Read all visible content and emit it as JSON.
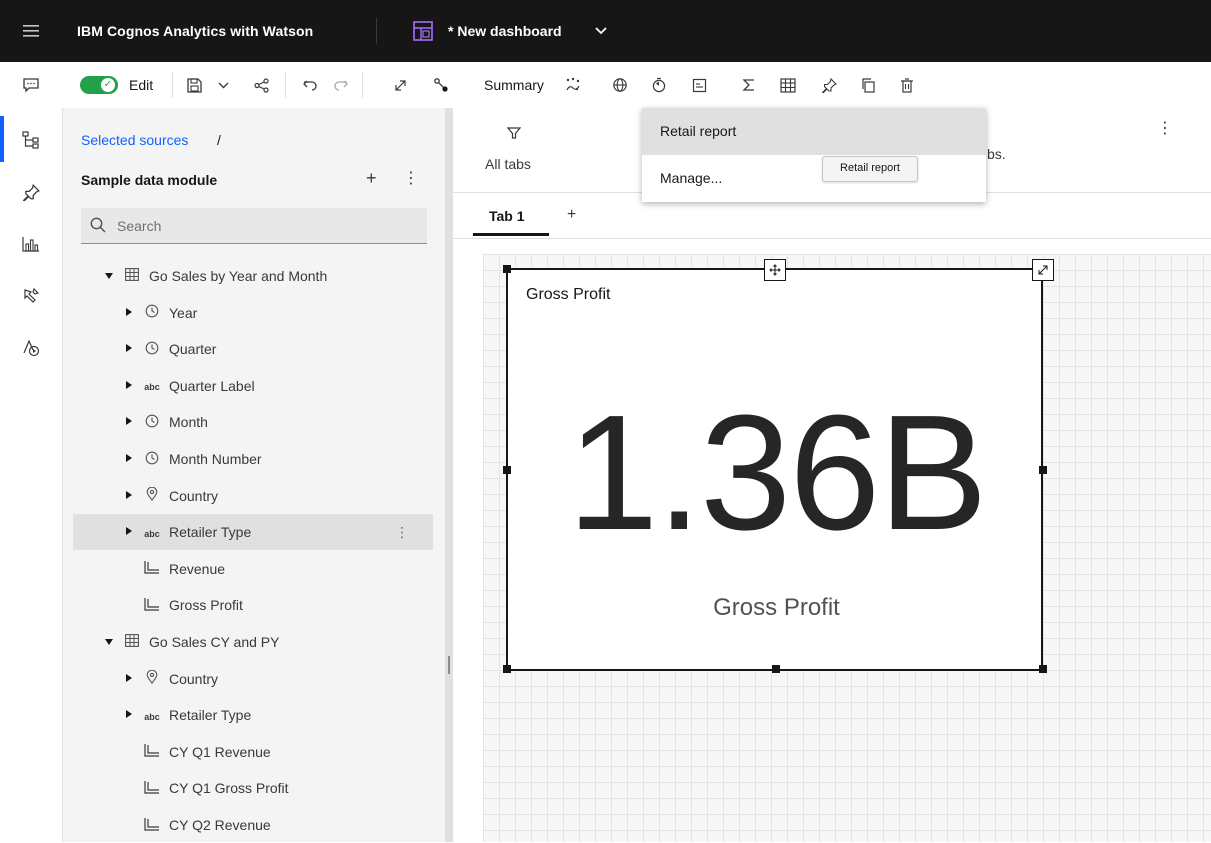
{
  "header": {
    "brand": "IBM Cognos Analytics with Watson",
    "dashboard_title": "* New dashboard"
  },
  "toolbar": {
    "edit_label": "Edit",
    "edit_on": true,
    "summary_label": "Summary"
  },
  "panel": {
    "breadcrumb_link": "Selected sources",
    "breadcrumb_sep": "/",
    "module_name": "Sample data module",
    "search_placeholder": "Search",
    "tree": [
      {
        "label": "Go Sales by Year and Month",
        "icon": "table-icon",
        "caret": "down",
        "level": 0
      },
      {
        "label": "Year",
        "icon": "clock-icon",
        "caret": "right",
        "level": 1
      },
      {
        "label": "Quarter",
        "icon": "clock-icon",
        "caret": "right",
        "level": 1
      },
      {
        "label": "Quarter Label",
        "icon": "abc-icon",
        "caret": "right",
        "level": 1
      },
      {
        "label": "Month",
        "icon": "clock-icon",
        "caret": "right",
        "level": 1
      },
      {
        "label": "Month Number",
        "icon": "clock-icon",
        "caret": "right",
        "level": 1
      },
      {
        "label": "Country",
        "icon": "location-icon",
        "caret": "right",
        "level": 1
      },
      {
        "label": "Retailer Type",
        "icon": "abc-icon",
        "caret": "right",
        "level": 1,
        "highlighted": true
      },
      {
        "label": "Revenue",
        "icon": "measure-icon",
        "caret": "none",
        "level": 1
      },
      {
        "label": "Gross Profit",
        "icon": "measure-icon",
        "caret": "none",
        "level": 1
      },
      {
        "label": "Go Sales CY and PY",
        "icon": "table-icon",
        "caret": "down",
        "level": 0
      },
      {
        "label": "Country",
        "icon": "location-icon",
        "caret": "right",
        "level": 1
      },
      {
        "label": "Retailer Type",
        "icon": "abc-icon",
        "caret": "right",
        "level": 1
      },
      {
        "label": "CY Q1 Revenue",
        "icon": "measure-icon",
        "caret": "none",
        "level": 1
      },
      {
        "label": "CY Q1 Gross Profit",
        "icon": "measure-icon",
        "caret": "none",
        "level": 1
      },
      {
        "label": "CY Q2 Revenue",
        "icon": "measure-icon",
        "caret": "none",
        "level": 1
      }
    ]
  },
  "main": {
    "all_tabs_label": "All tabs",
    "partial_text": "bs.",
    "tabs": [
      {
        "label": "Tab 1",
        "active": true
      }
    ],
    "add_tab": "+"
  },
  "widget": {
    "title": "Gross Profit",
    "value": "1.36B",
    "value_label": "Gross Profit"
  },
  "dropdown": {
    "options": [
      {
        "label": "Retail report",
        "selected": true
      },
      {
        "label": "Manage...",
        "selected": false
      }
    ],
    "tooltip": "Retail report"
  },
  "colors": {
    "header_bg": "#161616",
    "accent": "#0f62fe",
    "toggle_on": "#24a148"
  }
}
